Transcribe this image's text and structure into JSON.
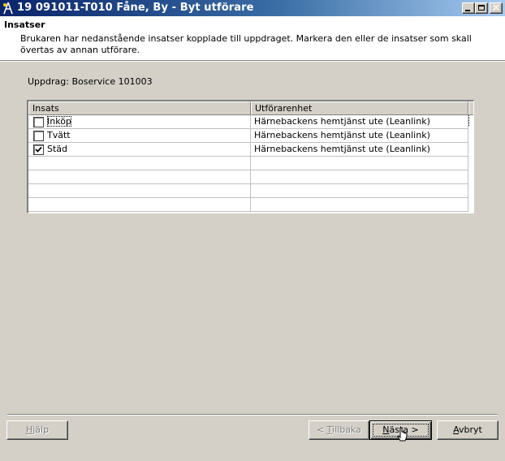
{
  "window": {
    "title": "19 091011-T010 Fåne, By - Byt utförare",
    "controls": {
      "minimize": "minimize-icon",
      "maximize": "maximize-icon",
      "close": "close-icon"
    }
  },
  "header": {
    "title": "Insatser",
    "description": "Brukaren har nedanstående insatser kopplade till uppdraget. Markera den eller de insatser som skall övertas av annan utförare."
  },
  "uppdrag_label": "Uppdrag: Boservice 101003",
  "grid": {
    "columns": [
      "Insats",
      "Utförarenhet"
    ],
    "rows": [
      {
        "insats": "Inköp",
        "utforarenhet": "Härnebackens hemtjänst ute (Leanlink)",
        "checked": false
      },
      {
        "insats": "Tvätt",
        "utforarenhet": "Härnebackens hemtjänst ute (Leanlink)",
        "checked": false
      },
      {
        "insats": "Städ",
        "utforarenhet": "Härnebackens hemtjänst ute (Leanlink)",
        "checked": true
      }
    ],
    "empty_rows": 4
  },
  "buttons": {
    "help": {
      "pre": "",
      "accel": "H",
      "post": "jälp",
      "enabled": false
    },
    "back": {
      "pre": "< ",
      "accel": "T",
      "post": "illbaka",
      "enabled": false
    },
    "next": {
      "pre": "",
      "accel": "N",
      "post": "ästa >",
      "enabled": true
    },
    "cancel": {
      "pre": "",
      "accel": "A",
      "post": "vbryt",
      "enabled": true
    }
  },
  "colors": {
    "title_gradient_start": "#0a246a",
    "title_gradient_end": "#a6caf0",
    "face": "#d4d0c8"
  }
}
